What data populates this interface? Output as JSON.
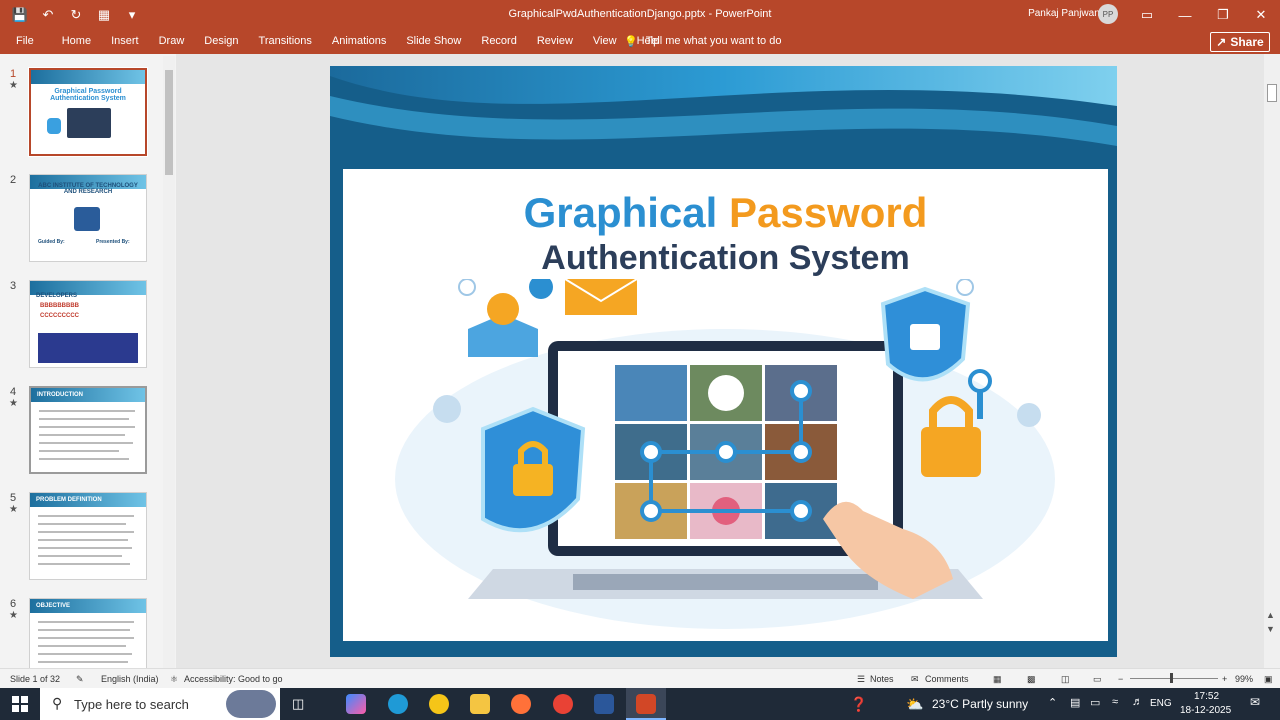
{
  "window": {
    "title": "GraphicalPwdAuthenticationDjango.pptx  -  PowerPoint",
    "user_name": "Pankaj Panjwani",
    "user_initials": "PP"
  },
  "ribbon": {
    "tabs": [
      "File",
      "Home",
      "Insert",
      "Draw",
      "Design",
      "Transitions",
      "Animations",
      "Slide Show",
      "Record",
      "Review",
      "View",
      "Help"
    ],
    "tell_me": "Tell me what you want to do",
    "share": "Share"
  },
  "thumbnails": [
    {
      "num": "1",
      "title": "Graphical Password Authentication System"
    },
    {
      "num": "2",
      "title": "ABC INSTITUTE OF TECHNOLOGY AND RESEARCH",
      "guided": "Guided By:",
      "presented": "Presented By:"
    },
    {
      "num": "3",
      "title": "DEVELOPERS",
      "line1": "BBBBBBBBB",
      "line2": "CCCCCCCCC"
    },
    {
      "num": "4",
      "title": "INTRODUCTION"
    },
    {
      "num": "5",
      "title": "PROBLEM DEFINITION"
    },
    {
      "num": "6",
      "title": "OBJECTIVE"
    }
  ],
  "slide": {
    "title_word1": "Graphical",
    "title_word2": "Password",
    "subtitle": "Authentication System"
  },
  "status": {
    "slide_counter": "Slide 1 of 32",
    "language": "English (India)",
    "accessibility": "Accessibility: Good to go",
    "notes": "Notes",
    "comments": "Comments",
    "zoom": "99%"
  },
  "taskbar": {
    "search_placeholder": "Type here to search",
    "weather": "23°C  Partly sunny",
    "lang": "ENG",
    "time": "17:52",
    "date": "18-12-2025"
  },
  "colors": {
    "accent": "#b7472a",
    "title_blue": "#2b8fd1",
    "title_orange": "#f39a1e",
    "subtitle": "#2c3e5a"
  }
}
